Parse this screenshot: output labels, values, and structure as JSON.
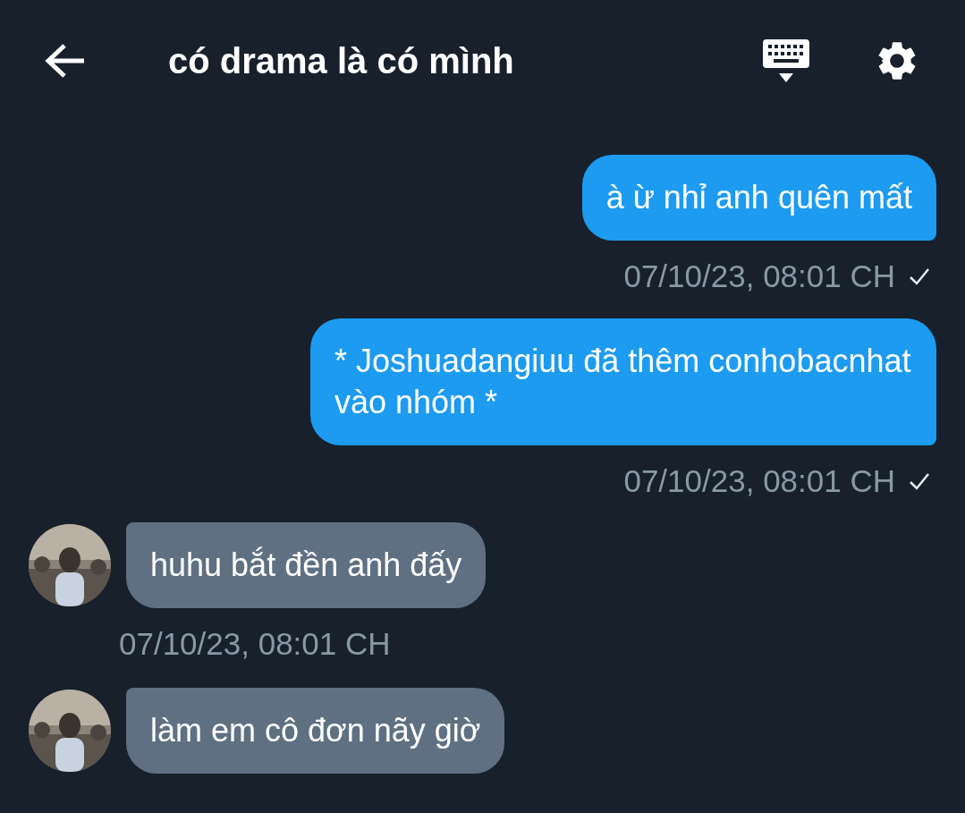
{
  "header": {
    "title": "có drama là có mình"
  },
  "messages": [
    {
      "kind": "sent",
      "text": "à ừ nhỉ anh quên mất",
      "time": "07/10/23, 08:01 CH",
      "read": true
    },
    {
      "kind": "sent",
      "text": "* Joshuadangiuu đã thêm conhobacnhat vào nhóm *",
      "time": "07/10/23, 08:01 CH",
      "read": true
    },
    {
      "kind": "received",
      "text": "huhu bắt đền anh đấy",
      "time": "07/10/23, 08:01 CH"
    },
    {
      "kind": "received",
      "text": "làm em cô đơn nãy giờ"
    }
  ]
}
